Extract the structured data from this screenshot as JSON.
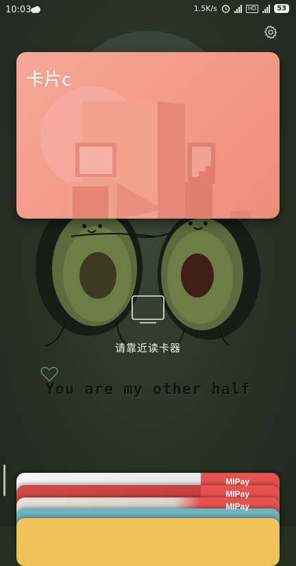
{
  "status_bar": {
    "time": "10:03",
    "network_speed": "1.5K/s",
    "hd_label": "HD",
    "battery": "53",
    "icons": [
      "weather-cloud-icon",
      "alarm-icon",
      "signal-icon",
      "hd-icon",
      "signal-4g-icon",
      "battery-icon"
    ]
  },
  "settings": {
    "icon": "gear-icon"
  },
  "card": {
    "title": "卡片c",
    "color": "#f49a8a"
  },
  "reader": {
    "icon": "nfc-reader-icon",
    "hint": "请靠近读卡器"
  },
  "background": {
    "slogan": "You are my other half"
  },
  "stacked_cards": {
    "brand_label": "MIPay",
    "colors": [
      "#e45a52",
      "#d94a46",
      "#e85450",
      "#5fb0c0",
      "#f0c25a"
    ]
  }
}
